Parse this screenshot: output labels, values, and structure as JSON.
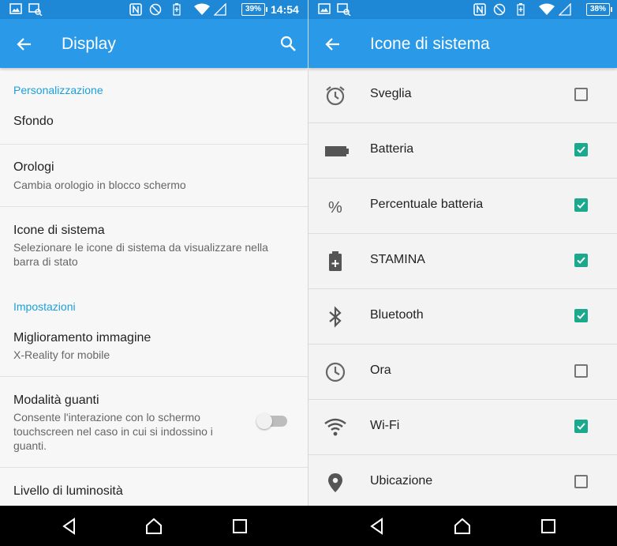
{
  "left": {
    "status": {
      "battery": "39%",
      "time": "14:54"
    },
    "appbar": {
      "title": "Display",
      "back_icon": "arrow-back-icon",
      "search_icon": "search-icon"
    },
    "sections": {
      "personalization": "Personalizzazione",
      "settings": "Impostazioni"
    },
    "items": {
      "wallpaper": {
        "title": "Sfondo"
      },
      "clocks": {
        "title": "Orologi",
        "subtitle": "Cambia orologio in blocco schermo"
      },
      "system_icons": {
        "title": "Icone di sistema",
        "subtitle": "Selezionare le icone di sistema da visualizzare nella barra di stato"
      },
      "image_enhancement": {
        "title": "Miglioramento immagine",
        "subtitle": "X-Reality for mobile"
      },
      "glove_mode": {
        "title": "Modalità guanti",
        "subtitle": "Consente l'interazione con lo schermo touchscreen nel caso in cui si indossino i guanti.",
        "enabled": false
      },
      "brightness": {
        "title": "Livello di luminosità"
      }
    }
  },
  "right": {
    "status": {
      "battery": "38%"
    },
    "appbar": {
      "title": "Icone di sistema",
      "back_icon": "arrow-back-icon"
    },
    "rows": [
      {
        "label": "Sveglia",
        "icon": "alarm-icon",
        "checked": false
      },
      {
        "label": "Batteria",
        "icon": "battery-icon",
        "checked": true
      },
      {
        "label": "Percentuale batteria",
        "icon": "percent-icon",
        "checked": true
      },
      {
        "label": "STAMINA",
        "icon": "stamina-icon",
        "checked": true
      },
      {
        "label": "Bluetooth",
        "icon": "bluetooth-icon",
        "checked": true
      },
      {
        "label": "Ora",
        "icon": "clock-icon",
        "checked": false
      },
      {
        "label": "Wi-Fi",
        "icon": "wifi-icon",
        "checked": true
      },
      {
        "label": "Ubicazione",
        "icon": "location-icon",
        "checked": false
      }
    ]
  },
  "colors": {
    "appbar": "#2a9ae8",
    "statusbar": "#1e88d6",
    "accent": "#1ba0dc",
    "checkbox": "#1aa98c"
  }
}
